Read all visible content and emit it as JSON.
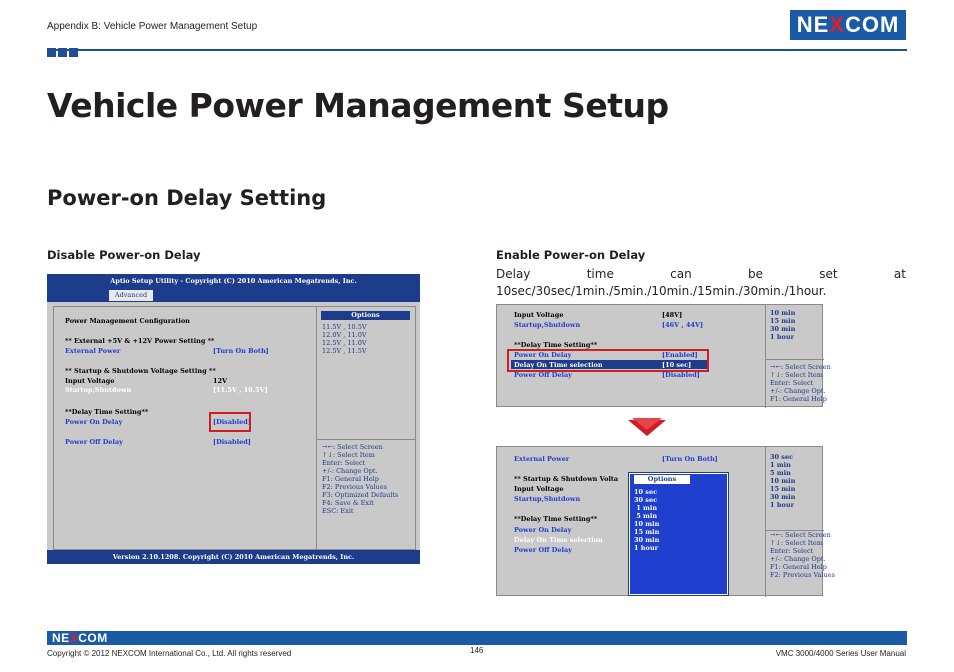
{
  "header": {
    "breadcrumb": "Appendix B: Vehicle Power Management Setup",
    "logo_pre": "NE",
    "logo_x": "X",
    "logo_post": "COM"
  },
  "title": "Vehicle Power Management Setup",
  "subtitle": "Power-on Delay Setting",
  "left": {
    "label": "Disable Power-on Delay",
    "topbar": "Aptio Setup Utility - Copyright (C) 2010 American Megatrends, Inc.",
    "tab": "Advanced",
    "rows": {
      "cfg": "Power Management Configuration",
      "ext_heading": "** External +5V & +12V Power Setting **",
      "ext_power_label": "External Power",
      "ext_power_value": "[Turn On Both]",
      "startup_heading": "** Startup & Shutdown Voltage Setting **",
      "input_voltage_label": "Input Voltage",
      "input_voltage_value": "12V",
      "startup_label": "Startup,Shutdown",
      "startup_value": "[11.5V , 10.5V]",
      "delay_heading": "**Delay Time Setting**",
      "power_on_label": "Power On Delay",
      "power_on_value": "[Disabled]",
      "power_off_label": "Power Off Delay",
      "power_off_value": "[Disabled]"
    },
    "options_title": "Options",
    "options": [
      "11.5V , 10.5V",
      "12.0V , 11.0V",
      "12.5V , 11.0V",
      "12.5V , 11.5V"
    ],
    "help": [
      "→←: Select Screen",
      "↑↓: Select Item",
      "Enter: Select",
      "+/-: Change Opt.",
      "F1: General Help",
      "F2: Previous Values",
      "F3: Optimized Defaults",
      "F4: Save & Exit",
      "ESC: Exit"
    ],
    "bottombar": "Version 2.10.1208. Copyright (C) 2010 American Megatrends, Inc."
  },
  "right": {
    "label": "Enable Power-on Delay",
    "description": "Delay time can be set at 10sec/30sec/1min./5min./10min./15min./30min./1hour.",
    "top_screen": {
      "input_voltage_label": "Input Voltage",
      "input_voltage_value": "[48V]",
      "startup_label": "Startup,Shutdown",
      "startup_value": "[46V , 44V]",
      "delay_heading": "**Delay Time Setting**",
      "power_on_label": "Power On Delay",
      "power_on_value": "[Enabled]",
      "delay_sel_label": "Delay On Time selection",
      "delay_sel_value": "[10 sec]",
      "power_off_label": "Power Off Delay",
      "power_off_value": "[Disabled]",
      "side_values": [
        "10 min",
        "15 min",
        "30 min",
        "1 hour"
      ],
      "help": [
        "→←: Select Screen",
        "↑↓: Select Item",
        "Enter: Select",
        "+/-: Change Opt.",
        "F1: General Help"
      ]
    },
    "bottom_screen": {
      "ext_power_label": "External Power",
      "ext_power_value": "[Turn On Both]",
      "startup_heading": "** Startup & Shutdown Volta",
      "input_voltage_label": "Input Voltage",
      "startup_label": "Startup,Shutdown",
      "delay_heading": "**Delay Time Setting**",
      "power_on_label": "Power On Delay",
      "delay_sel_label": "Delay On Time selection",
      "power_off_label": "Power Off Delay",
      "popup_title": "Options",
      "popup_options": [
        "10 sec",
        "30 sec",
        " 1 min",
        " 5 min",
        "10 min",
        "15 min",
        "30 min",
        "1 hour"
      ],
      "side_values": [
        "30 sec",
        "1 min",
        "5 min",
        "10 min",
        "15 min",
        "30 min",
        "1 hour"
      ],
      "help": [
        "→←: Select Screen",
        "↑↓: Select Item",
        "Enter: Select",
        "+/-: Change Opt.",
        "F1: General Help",
        "F2: Previous Values"
      ]
    }
  },
  "footer": {
    "logo_pre": "NE",
    "logo_x": "X",
    "logo_post": "COM",
    "copyright": "Copyright © 2012 NEXCOM International Co., Ltd. All rights reserved",
    "page": "146",
    "manual": "VMC 3000/4000 Series User Manual"
  },
  "colors": {
    "brand_blue": "#1b5aa6",
    "bios_blue": "#1d3c8c",
    "highlight_red": "#d01c24",
    "arrow_red": "#d01c24"
  }
}
